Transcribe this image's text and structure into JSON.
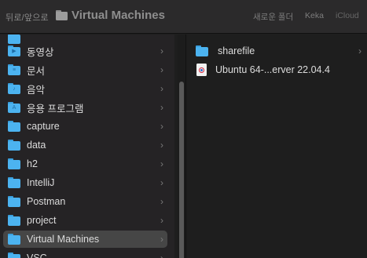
{
  "toolbar": {
    "back_label": "뒤로/앞으로",
    "title": "Virtual Machines",
    "new_folder": "새로운 폴더",
    "keka": "Keka",
    "icloud": "iCloud"
  },
  "sidebar": {
    "items": [
      {
        "label": "동영상",
        "icon": "video-folder-icon",
        "glyph": "▶"
      },
      {
        "label": "문서",
        "icon": "documents-folder-icon",
        "glyph": "≡"
      },
      {
        "label": "음악",
        "icon": "music-folder-icon",
        "glyph": "♪"
      },
      {
        "label": "응용 프로그램",
        "icon": "applications-folder-icon",
        "glyph": "A"
      },
      {
        "label": "capture",
        "icon": "folder-icon",
        "glyph": ""
      },
      {
        "label": "data",
        "icon": "folder-icon",
        "glyph": ""
      },
      {
        "label": "h2",
        "icon": "folder-icon",
        "glyph": ""
      },
      {
        "label": "IntelliJ",
        "icon": "folder-icon",
        "glyph": ""
      },
      {
        "label": "Postman",
        "icon": "folder-icon",
        "glyph": ""
      },
      {
        "label": "project",
        "icon": "folder-icon",
        "glyph": ""
      },
      {
        "label": "Virtual Machines",
        "icon": "folder-icon",
        "glyph": "",
        "selected": true
      },
      {
        "label": "VSC",
        "icon": "folder-icon",
        "glyph": ""
      }
    ],
    "chevron": "›"
  },
  "content": {
    "items": [
      {
        "label": "sharefile",
        "type": "folder"
      },
      {
        "label": "Ubuntu 64-...erver 22.04.4",
        "type": "vm"
      }
    ],
    "chevron": "›"
  },
  "colors": {
    "accent_folder": "#4cb3f0",
    "selection": "#464646",
    "background": "#1e1e1e"
  }
}
